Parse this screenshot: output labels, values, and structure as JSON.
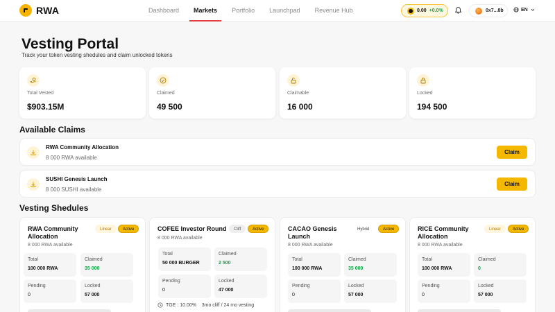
{
  "header": {
    "brand": "RWA",
    "nav": [
      "Dashboard",
      "Markets",
      "Portfolio",
      "Launchpad",
      "Revenue Hub"
    ],
    "active_nav": "Markets",
    "price": {
      "value": "0.00",
      "change": "+0.0%"
    },
    "wallet": "0x7...8b",
    "language": "EN"
  },
  "page": {
    "title": "Vesting Portal",
    "subtitle": "Track your token vesting shedules and claim unlocked tokens"
  },
  "stats": [
    {
      "label": "Total Vested",
      "value": "$903.15M",
      "icon": "coins-hand-icon"
    },
    {
      "label": "Claimed",
      "value": "49 500",
      "icon": "check-circle-icon"
    },
    {
      "label": "Claimable",
      "value": "16 000",
      "icon": "unlock-icon"
    },
    {
      "label": "Locked",
      "value": "194 500",
      "icon": "lock-icon"
    }
  ],
  "claims_section": {
    "title": "Available Claims",
    "items": [
      {
        "name": "RWA Community Allocation",
        "available": "8 000 RWA available",
        "button": "Claim"
      },
      {
        "name": "SUSHI Genesis Launch",
        "available": "8 000 SUSHI available",
        "button": "Claim"
      }
    ]
  },
  "schedules_section": {
    "title": "Vesting Shedules",
    "items": [
      {
        "name": "RWA Community Allocation",
        "type": "Linear",
        "status": "Active",
        "available": "8 000 RWA available",
        "labels": [
          "Total",
          "Claimed",
          "Pending",
          "Locked"
        ],
        "total": "100 000 RWA",
        "claimed": "35 000",
        "pending": "0",
        "locked": "57 000"
      },
      {
        "name": "COFEE Investor Round",
        "type": "Cliff",
        "status": "Active",
        "available": "8 000 RWA available",
        "labels": [
          "Total",
          "Claimed",
          "Pending",
          "Locked"
        ],
        "total": "50 000 BURGER",
        "claimed": "2 500",
        "pending": "0",
        "locked": "47 000",
        "note": "TGE : 10.00%    3mo cliff / 24 mo vesting"
      },
      {
        "name": "CACAO Genesis Launch",
        "type": "Hybrid",
        "status": "Active",
        "available": "8 000 RWA available",
        "labels": [
          "Total",
          "Claimed",
          "Pending",
          "Locked"
        ],
        "total": "100 000 RWA",
        "claimed": "35 000",
        "pending": "0",
        "locked": "57 000"
      },
      {
        "name": "RICE Community Allocation",
        "type": "Linear",
        "status": "Active",
        "available": "8 000 RWA available",
        "labels": [
          "Total",
          "Claimed",
          "Pending",
          "Locked"
        ],
        "total": "100 000 RWA",
        "claimed": "0",
        "pending": "0",
        "locked": "57 000"
      }
    ]
  }
}
